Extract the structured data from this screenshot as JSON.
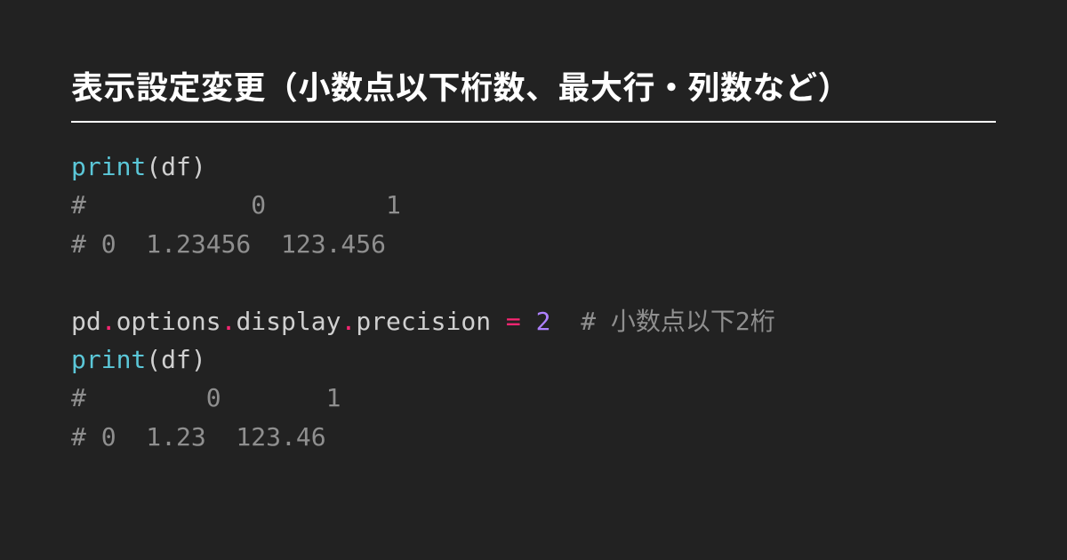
{
  "title": "表示設定変更（小数点以下桁数、最大行・列数など）",
  "code": {
    "l1_fn": "print",
    "l1_lp": "(",
    "l1_arg": "df",
    "l1_rp": ")",
    "l2": "#           0        1",
    "l3": "# 0  1.23456  123.456",
    "blank": "",
    "l5_pd": "pd",
    "l5_d1": ".",
    "l5_options": "options",
    "l5_d2": ".",
    "l5_display": "display",
    "l5_d3": ".",
    "l5_precision": "precision",
    "l5_sp1": " ",
    "l5_eq": "=",
    "l5_sp2": " ",
    "l5_val": "2",
    "l5_sp3": "  ",
    "l5_comment": "# 小数点以下2桁",
    "l6_fn": "print",
    "l6_lp": "(",
    "l6_arg": "df",
    "l6_rp": ")",
    "l7": "#        0       1",
    "l8": "# 0  1.23  123.46"
  }
}
